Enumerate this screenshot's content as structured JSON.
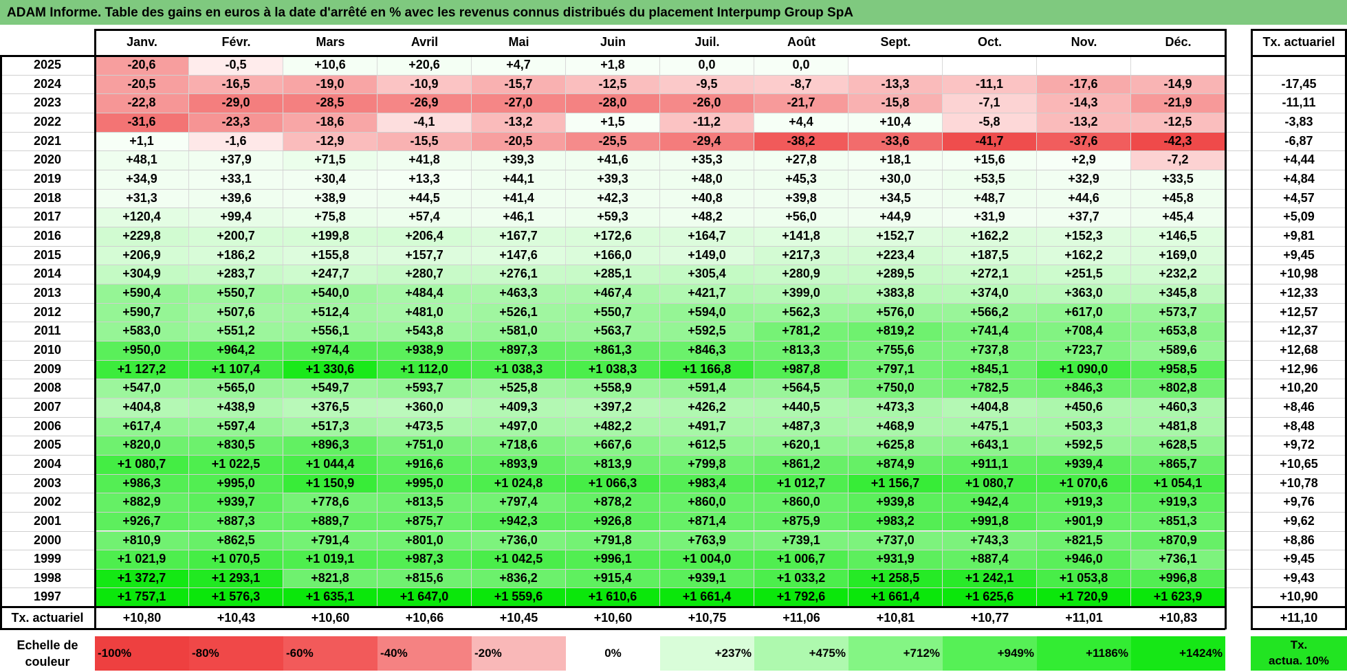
{
  "title": "ADAM Informe. Table des gains en euros à la date d'arrêté en % avec les revenus connus distribués du placement Interpump Group SpA",
  "chart_data": {
    "type": "table",
    "columns": [
      "Janv.",
      "Févr.",
      "Mars",
      "Avril",
      "Mai",
      "Juin",
      "Juil.",
      "Août",
      "Sept.",
      "Oct.",
      "Nov.",
      "Déc."
    ],
    "actuarial_header": "Tx. actuariel",
    "rows": [
      {
        "year": "2025",
        "values": [
          "-20,6",
          "-0,5",
          "+10,6",
          "+20,6",
          "+4,7",
          "+1,8",
          "0,0",
          "0,0",
          "",
          "",
          "",
          ""
        ],
        "actuarial": ""
      },
      {
        "year": "2024",
        "values": [
          "-20,5",
          "-16,5",
          "-19,0",
          "-10,9",
          "-15,7",
          "-12,5",
          "-9,5",
          "-8,7",
          "-13,3",
          "-11,1",
          "-17,6",
          "-14,9"
        ],
        "actuarial": "-17,45"
      },
      {
        "year": "2023",
        "values": [
          "-22,8",
          "-29,0",
          "-28,5",
          "-26,9",
          "-27,0",
          "-28,0",
          "-26,0",
          "-21,7",
          "-15,8",
          "-7,1",
          "-14,3",
          "-21,9"
        ],
        "actuarial": "-11,11"
      },
      {
        "year": "2022",
        "values": [
          "-31,6",
          "-23,3",
          "-18,6",
          "-4,1",
          "-13,2",
          "+1,5",
          "-11,2",
          "+4,4",
          "+10,4",
          "-5,8",
          "-13,2",
          "-12,5"
        ],
        "actuarial": "-3,83"
      },
      {
        "year": "2021",
        "values": [
          "+1,1",
          "-1,6",
          "-12,9",
          "-15,5",
          "-20,5",
          "-25,5",
          "-29,4",
          "-38,2",
          "-33,6",
          "-41,7",
          "-37,6",
          "-42,3"
        ],
        "actuarial": "-6,87"
      },
      {
        "year": "2020",
        "values": [
          "+48,1",
          "+37,9",
          "+71,5",
          "+41,8",
          "+39,3",
          "+41,6",
          "+35,3",
          "+27,8",
          "+18,1",
          "+15,6",
          "+2,9",
          "-7,2"
        ],
        "actuarial": "+4,44"
      },
      {
        "year": "2019",
        "values": [
          "+34,9",
          "+33,1",
          "+30,4",
          "+13,3",
          "+44,1",
          "+39,3",
          "+48,0",
          "+45,3",
          "+30,0",
          "+53,5",
          "+32,9",
          "+33,5"
        ],
        "actuarial": "+4,84"
      },
      {
        "year": "2018",
        "values": [
          "+31,3",
          "+39,6",
          "+38,9",
          "+44,5",
          "+41,4",
          "+42,3",
          "+40,8",
          "+39,8",
          "+34,5",
          "+48,7",
          "+44,6",
          "+45,8"
        ],
        "actuarial": "+4,57"
      },
      {
        "year": "2017",
        "values": [
          "+120,4",
          "+99,4",
          "+75,8",
          "+57,4",
          "+46,1",
          "+59,3",
          "+48,2",
          "+56,0",
          "+44,9",
          "+31,9",
          "+37,7",
          "+45,4"
        ],
        "actuarial": "+5,09"
      },
      {
        "year": "2016",
        "values": [
          "+229,8",
          "+200,7",
          "+199,8",
          "+206,4",
          "+167,7",
          "+172,6",
          "+164,7",
          "+141,8",
          "+152,7",
          "+162,2",
          "+152,3",
          "+146,5"
        ],
        "actuarial": "+9,81"
      },
      {
        "year": "2015",
        "values": [
          "+206,9",
          "+186,2",
          "+155,8",
          "+157,7",
          "+147,6",
          "+166,0",
          "+149,0",
          "+217,3",
          "+223,4",
          "+187,5",
          "+162,2",
          "+169,0"
        ],
        "actuarial": "+9,45"
      },
      {
        "year": "2014",
        "values": [
          "+304,9",
          "+283,7",
          "+247,7",
          "+280,7",
          "+276,1",
          "+285,1",
          "+305,4",
          "+280,9",
          "+289,5",
          "+272,1",
          "+251,5",
          "+232,2"
        ],
        "actuarial": "+10,98"
      },
      {
        "year": "2013",
        "values": [
          "+590,4",
          "+550,7",
          "+540,0",
          "+484,4",
          "+463,3",
          "+467,4",
          "+421,7",
          "+399,0",
          "+383,8",
          "+374,0",
          "+363,0",
          "+345,8"
        ],
        "actuarial": "+12,33"
      },
      {
        "year": "2012",
        "values": [
          "+590,7",
          "+507,6",
          "+512,4",
          "+481,0",
          "+526,1",
          "+550,7",
          "+594,0",
          "+562,3",
          "+576,0",
          "+566,2",
          "+617,0",
          "+573,7"
        ],
        "actuarial": "+12,57"
      },
      {
        "year": "2011",
        "values": [
          "+583,0",
          "+551,2",
          "+556,1",
          "+543,8",
          "+581,0",
          "+563,7",
          "+592,5",
          "+781,2",
          "+819,2",
          "+741,4",
          "+708,4",
          "+653,8"
        ],
        "actuarial": "+12,37"
      },
      {
        "year": "2010",
        "values": [
          "+950,0",
          "+964,2",
          "+974,4",
          "+938,9",
          "+897,3",
          "+861,3",
          "+846,3",
          "+813,3",
          "+755,6",
          "+737,8",
          "+723,7",
          "+589,6"
        ],
        "actuarial": "+12,68"
      },
      {
        "year": "2009",
        "values": [
          "+1 127,2",
          "+1 107,4",
          "+1 330,6",
          "+1 112,0",
          "+1 038,3",
          "+1 038,3",
          "+1 166,8",
          "+987,8",
          "+797,1",
          "+845,1",
          "+1 090,0",
          "+958,5"
        ],
        "actuarial": "+12,96"
      },
      {
        "year": "2008",
        "values": [
          "+547,0",
          "+565,0",
          "+549,7",
          "+593,7",
          "+525,8",
          "+558,9",
          "+591,4",
          "+564,5",
          "+750,0",
          "+782,5",
          "+846,3",
          "+802,8"
        ],
        "actuarial": "+10,20"
      },
      {
        "year": "2007",
        "values": [
          "+404,8",
          "+438,9",
          "+376,5",
          "+360,0",
          "+409,3",
          "+397,2",
          "+426,2",
          "+440,5",
          "+473,3",
          "+404,8",
          "+450,6",
          "+460,3"
        ],
        "actuarial": "+8,46"
      },
      {
        "year": "2006",
        "values": [
          "+617,4",
          "+597,4",
          "+517,3",
          "+473,5",
          "+497,0",
          "+482,2",
          "+491,7",
          "+487,3",
          "+468,9",
          "+475,1",
          "+503,3",
          "+481,8"
        ],
        "actuarial": "+8,48"
      },
      {
        "year": "2005",
        "values": [
          "+820,0",
          "+830,5",
          "+896,3",
          "+751,0",
          "+718,6",
          "+667,6",
          "+612,5",
          "+620,1",
          "+625,8",
          "+643,1",
          "+592,5",
          "+628,5"
        ],
        "actuarial": "+9,72"
      },
      {
        "year": "2004",
        "values": [
          "+1 080,7",
          "+1 022,5",
          "+1 044,4",
          "+916,6",
          "+893,9",
          "+813,9",
          "+799,8",
          "+861,2",
          "+874,9",
          "+911,1",
          "+939,4",
          "+865,7"
        ],
        "actuarial": "+10,65"
      },
      {
        "year": "2003",
        "values": [
          "+986,3",
          "+995,0",
          "+1 150,9",
          "+995,0",
          "+1 024,8",
          "+1 066,3",
          "+983,4",
          "+1 012,7",
          "+1 156,7",
          "+1 080,7",
          "+1 070,6",
          "+1 054,1"
        ],
        "actuarial": "+10,78"
      },
      {
        "year": "2002",
        "values": [
          "+882,9",
          "+939,7",
          "+778,6",
          "+813,5",
          "+797,4",
          "+878,2",
          "+860,0",
          "+860,0",
          "+939,8",
          "+942,4",
          "+919,3",
          "+919,3"
        ],
        "actuarial": "+9,76"
      },
      {
        "year": "2001",
        "values": [
          "+926,7",
          "+887,3",
          "+889,7",
          "+875,7",
          "+942,3",
          "+926,8",
          "+871,4",
          "+875,9",
          "+983,2",
          "+991,8",
          "+901,9",
          "+851,3"
        ],
        "actuarial": "+9,62"
      },
      {
        "year": "2000",
        "values": [
          "+810,9",
          "+862,5",
          "+791,4",
          "+801,0",
          "+736,0",
          "+791,8",
          "+763,9",
          "+739,1",
          "+737,0",
          "+743,3",
          "+821,5",
          "+870,9"
        ],
        "actuarial": "+8,86"
      },
      {
        "year": "1999",
        "values": [
          "+1 021,9",
          "+1 070,5",
          "+1 019,1",
          "+987,3",
          "+1 042,5",
          "+996,1",
          "+1 004,0",
          "+1 006,7",
          "+931,9",
          "+887,4",
          "+946,0",
          "+736,1"
        ],
        "actuarial": "+9,45"
      },
      {
        "year": "1998",
        "values": [
          "+1 372,7",
          "+1 293,1",
          "+821,8",
          "+815,6",
          "+836,2",
          "+915,4",
          "+939,1",
          "+1 033,2",
          "+1 258,5",
          "+1 242,1",
          "+1 053,8",
          "+996,8"
        ],
        "actuarial": "+9,43"
      },
      {
        "year": "1997",
        "values": [
          "+1 757,1",
          "+1 576,3",
          "+1 635,1",
          "+1 647,0",
          "+1 559,6",
          "+1 610,6",
          "+1 661,4",
          "+1 792,6",
          "+1 661,4",
          "+1 625,6",
          "+1 720,9",
          "+1 623,9"
        ],
        "actuarial": "+10,90"
      }
    ],
    "footer": {
      "label": "Tx. actuariel",
      "values": [
        "+10,80",
        "+10,43",
        "+10,60",
        "+10,66",
        "+10,45",
        "+10,60",
        "+10,75",
        "+11,06",
        "+10,81",
        "+10,77",
        "+11,01",
        "+10,83"
      ],
      "actuarial": "+11,10"
    },
    "scale": {
      "label_line1": "Echelle de",
      "label_line2": "couleur",
      "items": [
        {
          "label": "-100%",
          "color": "#ee4040"
        },
        {
          "label": "-80%",
          "color": "#f04848"
        },
        {
          "label": "-60%",
          "color": "#f25a5a"
        },
        {
          "label": "-40%",
          "color": "#f58282"
        },
        {
          "label": "-20%",
          "color": "#f9b8b8"
        },
        {
          "label": "0%",
          "color": "#ffffff"
        },
        {
          "label": "+237%",
          "color": "#d9fdd9"
        },
        {
          "label": "+475%",
          "color": "#aef9ae"
        },
        {
          "label": "+712%",
          "color": "#84f584"
        },
        {
          "label": "+949%",
          "color": "#56f056"
        },
        {
          "label": "+1186%",
          "color": "#33ec33"
        },
        {
          "label": "+1424%",
          "color": "#16e716"
        }
      ],
      "actuarial_label_line1": "Tx.",
      "actuarial_label_line2": "actua. 10%",
      "actuarial_color": "#22e422"
    }
  }
}
